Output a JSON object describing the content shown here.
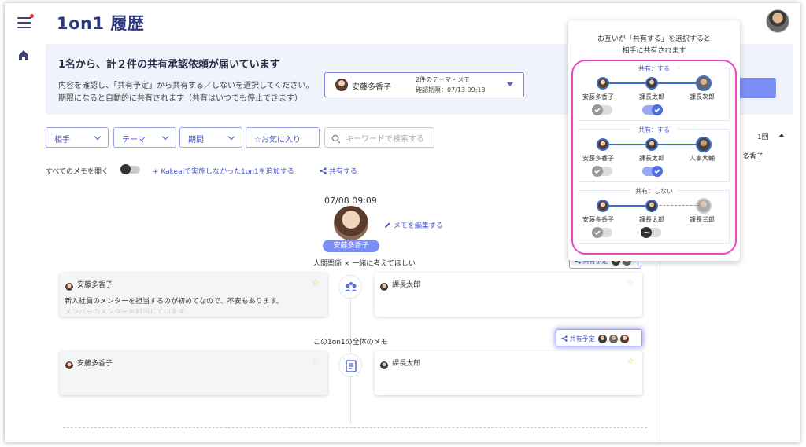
{
  "header": {
    "title": "1on1 履歴"
  },
  "banner": {
    "title": "1名から、計２件の共有承認依頼が届いています",
    "line1": "内容を確認し、「共有予定」から共有する／しないを選択してください。",
    "line2": "期限になると自動的に共有されます（共有はいつでも停止できます）",
    "request": {
      "name": "安藤多香子",
      "count": "2件のテーマ・メモ",
      "deadline": "確認期限：07/13 09:13"
    }
  },
  "filters": {
    "partner": "相手",
    "theme": "テーマ",
    "period": "期間",
    "favorites": "☆お気に入り",
    "search_placeholder": "キーワードで検索する"
  },
  "actions": {
    "open_all": "すべてのメモを開く",
    "add_link": "+ Kakeaiで実施しなかった1on1を追加する",
    "share": "共有する"
  },
  "entry": {
    "datetime": "07/08 09:09",
    "person": "安藤多香子",
    "edit_memo": "メモを編集する",
    "sections": [
      {
        "label": "人間関係 × 一緒に考えてほしい",
        "share_chip": "共有予定",
        "left_name": "安藤多香子",
        "left_text": "新入社員のメンターを担当するのが初めてなので、不安もあります。",
        "left_text_fade": "メンバーのメンターを担当しています",
        "right_name": "課長太郎"
      },
      {
        "label": "この1on1の全体のメモ",
        "share_chip": "共有予定",
        "left_name": "安藤多香子",
        "right_name": "課長太郎"
      }
    ]
  },
  "side": {
    "count": "1回",
    "name": "多香子"
  },
  "popup": {
    "title_line1": "お互いが「共有する」を選択すると",
    "title_line2": "相手に共有されます",
    "cases": [
      {
        "label": "共有：する",
        "names": [
          "安藤多香子",
          "課長太郎",
          "課長次郎"
        ]
      },
      {
        "label": "共有：する",
        "names": [
          "安藤多香子",
          "課長太郎",
          "人事大輔"
        ]
      },
      {
        "label": "共有：しない",
        "names": [
          "安藤多香子",
          "課長太郎",
          "課長三郎"
        ]
      }
    ]
  },
  "colors": {
    "brand": "#2f3a7d",
    "accent": "#7b8ef5",
    "link": "#4b57c8",
    "highlight": "#ee44c6"
  }
}
